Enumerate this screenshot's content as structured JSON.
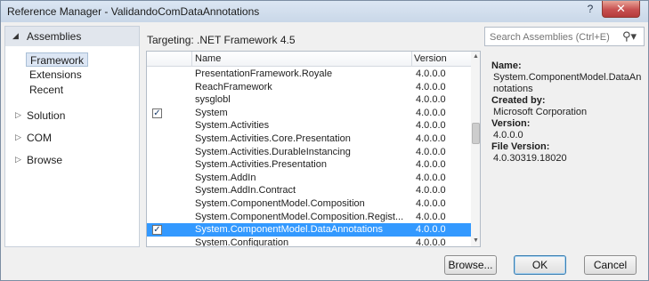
{
  "window": {
    "title": "Reference Manager - ValidandoComDataAnnotations",
    "help_label": "?",
    "close_label": "✕"
  },
  "sidebar": {
    "header": "Assemblies",
    "sub_items": [
      {
        "label": "Framework",
        "selected": true
      },
      {
        "label": "Extensions",
        "selected": false
      },
      {
        "label": "Recent",
        "selected": false
      }
    ],
    "categories": [
      {
        "label": "Solution"
      },
      {
        "label": "COM"
      },
      {
        "label": "Browse"
      }
    ]
  },
  "targeting": "Targeting: .NET Framework 4.5",
  "search": {
    "placeholder": "Search Assemblies (Ctrl+E)",
    "icon": "search-icon"
  },
  "list": {
    "columns": {
      "name": "Name",
      "version": "Version"
    },
    "rows": [
      {
        "name": "PresentationFramework.Royale",
        "version": "4.0.0.0",
        "checked": false,
        "selected": false
      },
      {
        "name": "ReachFramework",
        "version": "4.0.0.0",
        "checked": false,
        "selected": false
      },
      {
        "name": "sysglobl",
        "version": "4.0.0.0",
        "checked": false,
        "selected": false
      },
      {
        "name": "System",
        "version": "4.0.0.0",
        "checked": true,
        "selected": false
      },
      {
        "name": "System.Activities",
        "version": "4.0.0.0",
        "checked": false,
        "selected": false
      },
      {
        "name": "System.Activities.Core.Presentation",
        "version": "4.0.0.0",
        "checked": false,
        "selected": false
      },
      {
        "name": "System.Activities.DurableInstancing",
        "version": "4.0.0.0",
        "checked": false,
        "selected": false
      },
      {
        "name": "System.Activities.Presentation",
        "version": "4.0.0.0",
        "checked": false,
        "selected": false
      },
      {
        "name": "System.AddIn",
        "version": "4.0.0.0",
        "checked": false,
        "selected": false
      },
      {
        "name": "System.AddIn.Contract",
        "version": "4.0.0.0",
        "checked": false,
        "selected": false
      },
      {
        "name": "System.ComponentModel.Composition",
        "version": "4.0.0.0",
        "checked": false,
        "selected": false
      },
      {
        "name": "System.ComponentModel.Composition.Regist...",
        "version": "4.0.0.0",
        "checked": false,
        "selected": false
      },
      {
        "name": "System.ComponentModel.DataAnnotations",
        "version": "4.0.0.0",
        "checked": true,
        "selected": true
      },
      {
        "name": "System.Configuration",
        "version": "4.0.0.0",
        "checked": false,
        "selected": false
      }
    ]
  },
  "details": {
    "name_label": "Name:",
    "name_value": "System.ComponentModel.DataAnnotations",
    "created_label": "Created by:",
    "created_value": "Microsoft Corporation",
    "version_label": "Version:",
    "version_value": "4.0.0.0",
    "file_version_label": "File Version:",
    "file_version_value": "4.0.30319.18020"
  },
  "buttons": {
    "browse": "Browse...",
    "ok": "OK",
    "cancel": "Cancel"
  }
}
